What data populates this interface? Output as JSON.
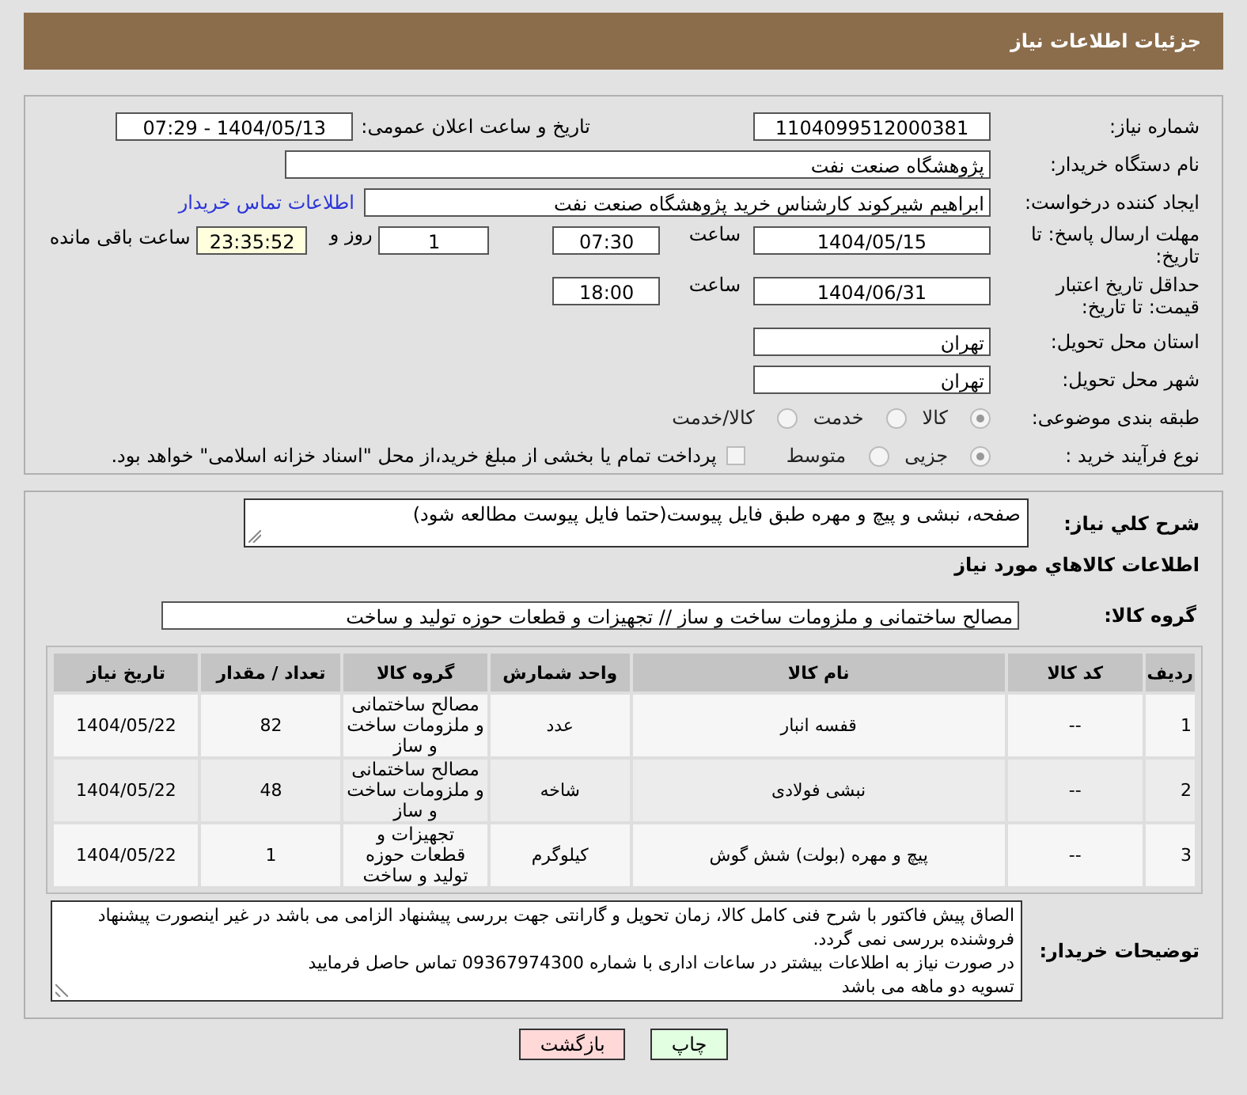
{
  "header": {
    "title": "جزئیات اطلاعات نیاز"
  },
  "need_number": {
    "label": "شماره نیاز:",
    "value": "1104099512000381"
  },
  "announce": {
    "label": "تاریخ و ساعت اعلان عمومی:",
    "value": "1404/05/13 - 07:29"
  },
  "buyer_org": {
    "label": "نام دستگاه خریدار:",
    "value": "پژوهشگاه صنعت نفت"
  },
  "requester": {
    "label": "ایجاد کننده درخواست:",
    "value": "ابراهیم شیرکوند کارشناس خرید پژوهشگاه صنعت نفت",
    "link": "اطلاعات تماس خریدار"
  },
  "reply_deadline": {
    "label": "مهلت ارسال پاسخ: تا تاریخ:",
    "date": "1404/05/15",
    "time_label": "ساعت",
    "time": "07:30",
    "days": "1",
    "days_label": "روز و",
    "remaining": "23:35:52",
    "remaining_label": "ساعت باقی مانده"
  },
  "price_validity": {
    "label": "حداقل تاریخ اعتبار قیمت: تا تاریخ:",
    "date": "1404/06/31",
    "time_label": "ساعت",
    "time": "18:00"
  },
  "province": {
    "label": "استان محل تحویل:",
    "value": "تهران"
  },
  "city": {
    "label": "شهر محل تحویل:",
    "value": "تهران"
  },
  "category": {
    "label": "طبقه بندی موضوعی:",
    "options": [
      {
        "label": "کالا",
        "selected": true
      },
      {
        "label": "خدمت",
        "selected": false
      },
      {
        "label": "کالا/خدمت",
        "selected": false
      }
    ]
  },
  "purchase_type": {
    "label": "نوع فرآیند خرید :",
    "options": [
      {
        "label": "جزیی",
        "selected": true
      },
      {
        "label": "متوسط",
        "selected": false
      }
    ],
    "payment": {
      "label": "پرداخت تمام یا بخشی از مبلغ خرید،از محل \"اسناد خزانه اسلامی\" خواهد بود.",
      "checked": false
    }
  },
  "summary": {
    "label": "شرح کلي نياز:",
    "value": "صفحه، نبشی و پیچ و مهره طبق فایل پیوست(حتما فایل پیوست مطالعه شود)"
  },
  "goods_title": "اطلاعات کالاهاي مورد نياز",
  "goods_group": {
    "label": "گروه کالا:",
    "value": "مصالح ساختمانی و ملزومات ساخت و ساز // تجهیزات و قطعات حوزه تولید و ساخت"
  },
  "table": {
    "columns": [
      "ردیف",
      "کد کالا",
      "نام کالا",
      "واحد شمارش",
      "گروه کالا",
      "تعداد / مقدار",
      "تاریخ نیاز"
    ],
    "rows": [
      [
        "1",
        "--",
        "قفسه انبار",
        "عدد",
        "مصالح ساختمانی و ملزومات ساخت و ساز",
        "82",
        "1404/05/22"
      ],
      [
        "2",
        "--",
        "نبشی فولادی",
        "شاخه",
        "مصالح ساختمانی و ملزومات ساخت و ساز",
        "48",
        "1404/05/22"
      ],
      [
        "3",
        "--",
        "پیچ و مهره (بولت) شش گوش",
        "کیلوگرم",
        "تجهیزات و قطعات حوزه تولید و ساخت",
        "1",
        "1404/05/22"
      ]
    ]
  },
  "buyer_notes": {
    "label": "توضیحات خریدار:",
    "value": "الصاق پیش فاکتور با شرح فنی کامل کالا، زمان تحویل و گارانتی جهت بررسی پیشنهاد الزامی می باشد در غیر اینصورت پیشنهاد فروشنده بررسی نمی گردد.\nدر صورت نیاز به اطلاعات بیشتر در ساعات اداری با شماره 09367974300 تماس حاصل فرمایید\nتسویه دو ماهه می باشد"
  },
  "buttons": [
    {
      "label": "چاپ",
      "kind": "print"
    },
    {
      "label": "بازگشت",
      "kind": "back"
    }
  ]
}
